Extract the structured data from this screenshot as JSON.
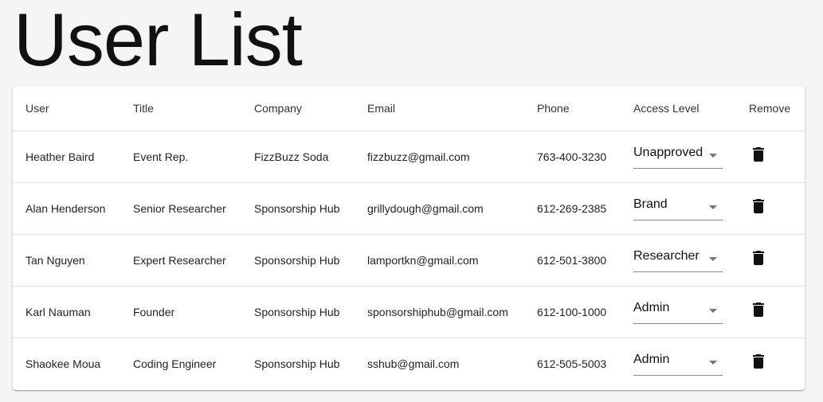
{
  "page": {
    "title": "User List"
  },
  "table": {
    "headers": {
      "user": "User",
      "title": "Title",
      "company": "Company",
      "email": "Email",
      "phone": "Phone",
      "access": "Access Level",
      "remove": "Remove"
    },
    "rows": [
      {
        "user": "Heather Baird",
        "title": "Event Rep.",
        "company": "FizzBuzz Soda",
        "email": "fizzbuzz@gmail.com",
        "phone": "763-400-3230",
        "access": "Unapproved"
      },
      {
        "user": "Alan Henderson",
        "title": "Senior Researcher",
        "company": "Sponsorship Hub",
        "email": "grillydough@gmail.com",
        "phone": "612-269-2385",
        "access": "Brand"
      },
      {
        "user": "Tan Nguyen",
        "title": "Expert Researcher",
        "company": "Sponsorship Hub",
        "email": "lamportkn@gmail.com",
        "phone": "612-501-3800",
        "access": "Researcher"
      },
      {
        "user": "Karl Nauman",
        "title": "Founder",
        "company": "Sponsorship Hub",
        "email": "sponsorshiphub@gmail.com",
        "phone": "612-100-1000",
        "access": "Admin"
      },
      {
        "user": "Shaokee Moua",
        "title": "Coding Engineer",
        "company": "Sponsorship Hub",
        "email": "sshub@gmail.com",
        "phone": "612-505-5003",
        "access": "Admin"
      }
    ]
  },
  "icons": {
    "remove": "trash-icon",
    "dropdown": "arrow-drop-down-icon"
  }
}
